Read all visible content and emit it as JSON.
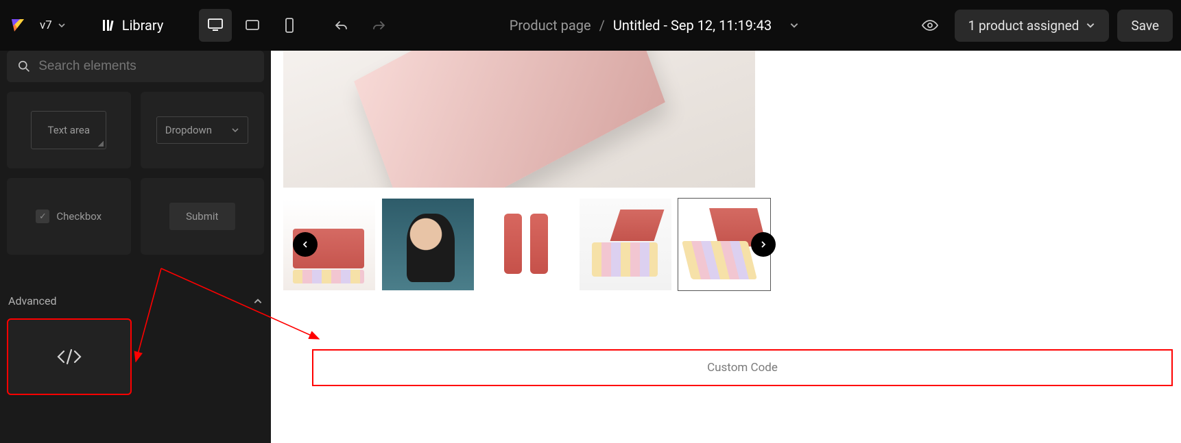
{
  "topbar": {
    "version": "v7",
    "library_label": "Library",
    "page_type": "Product page",
    "separator": "/",
    "page_name": "Untitled - Sep 12, 11:19:43",
    "assign_label": "1 product assigned",
    "save_label": "Save"
  },
  "sidebar": {
    "search_placeholder": "Search elements",
    "elements": {
      "textarea": "Text area",
      "dropdown": "Dropdown",
      "checkbox": "Checkbox",
      "submit": "Submit"
    },
    "section_advanced": "Advanced"
  },
  "canvas": {
    "custom_code_label": "Custom Code"
  },
  "colors": {
    "annotation": "#ff0000",
    "panel_bg": "#1a1a1a",
    "topbar_bg": "#0d0d0d"
  }
}
